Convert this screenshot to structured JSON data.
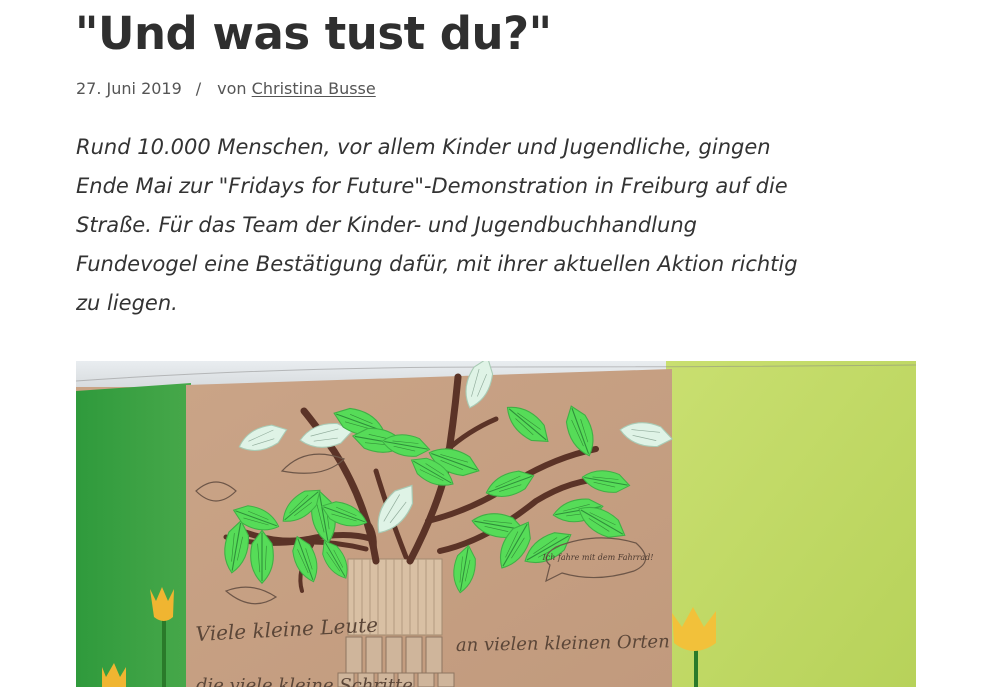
{
  "article": {
    "title": "\"Und was tust du?\"",
    "date": "27. Juni 2019",
    "separator": "/",
    "author_prefix": "von",
    "author": "Christina Busse",
    "lead_line_1": "Rund 10.000 Menschen, vor allem Kinder und Jugendliche, gingen",
    "lead_line_2": "Ende Mai zur \"Fridays for Future\"-Demonstration in Freiburg auf die",
    "lead_line_3": "Straße. Für das Team der Kinder- und Jugendbuchhandlung",
    "lead_line_4": "Fundevogel eine Bestätigung dafür, mit ihrer aktuellen Aktion richtig",
    "lead_line_5": "zu liegen.",
    "image": {
      "handwriting_left": "Viele kleine Leute",
      "handwriting_right": "an vielen kleinen Orten",
      "handwriting_bottom": "die viele kleine Schritte",
      "speech_bubble": "Ich fahre mit dem Fahrrad!"
    }
  },
  "colors": {
    "text": "#2f2f2f",
    "meta": "#555555",
    "paper_brown": "#c9a184",
    "green_left": "#3fa045",
    "green_right": "#c6de6a",
    "leaf_green": "#57dd5a",
    "leaf_pale": "#dcf2e4",
    "branch": "#5a3428"
  }
}
